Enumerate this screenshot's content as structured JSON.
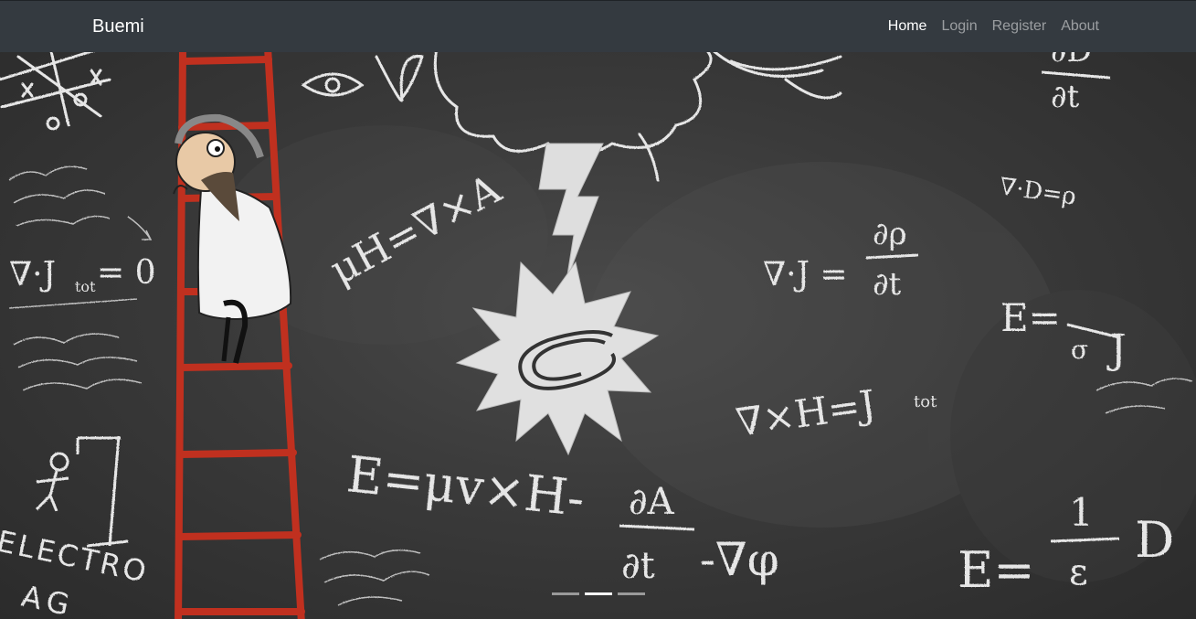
{
  "navbar": {
    "brand": "Buemi",
    "links": [
      {
        "label": "Home",
        "active": true
      },
      {
        "label": "Login",
        "active": false
      },
      {
        "label": "Register",
        "active": false
      },
      {
        "label": "About",
        "active": false
      }
    ]
  },
  "carousel": {
    "slide_count": 3,
    "active_slide": 2,
    "chalk_text": {
      "eq_divj": "∇·J",
      "eq_divj_sub": "tot",
      "eq_divj_rhs": "= 0",
      "eq_muh": "μH=∇×A",
      "eq_divd": "∇·D=ρ",
      "eq_cont_lhs": "∇·J =",
      "eq_cont_num": "∂ρ",
      "eq_cont_den": "∂t",
      "eq_e_sigma_lhs": "E=",
      "eq_e_sigma_den": "σ",
      "eq_e_sigma_rhs": "J",
      "eq_curlh": "∇×H=J",
      "eq_curlh_sub": "tot",
      "eq_e_main": "E=μv×H-",
      "eq_e_main_num": "∂A",
      "eq_e_main_den": "∂t",
      "eq_e_main_rhs": "-∇φ",
      "eq_e_d_lhs": "E=",
      "eq_e_d_num": "1",
      "eq_e_d_den": "ε",
      "eq_e_d_rhs": "D",
      "eq_top_num": "∂D",
      "eq_top_den": "∂t",
      "electro": "ELECTRO",
      "electro2": "AG",
      "tictac": "X O X"
    }
  },
  "colors": {
    "navbar_bg": "#343a40",
    "chalk": "#e6e6e6",
    "ladder": "#c0301f",
    "board": "#3a3a3a"
  },
  "icons": [
    "eye-icon",
    "lightning-bolt-icon",
    "magnet-icon",
    "hangman-icon"
  ]
}
